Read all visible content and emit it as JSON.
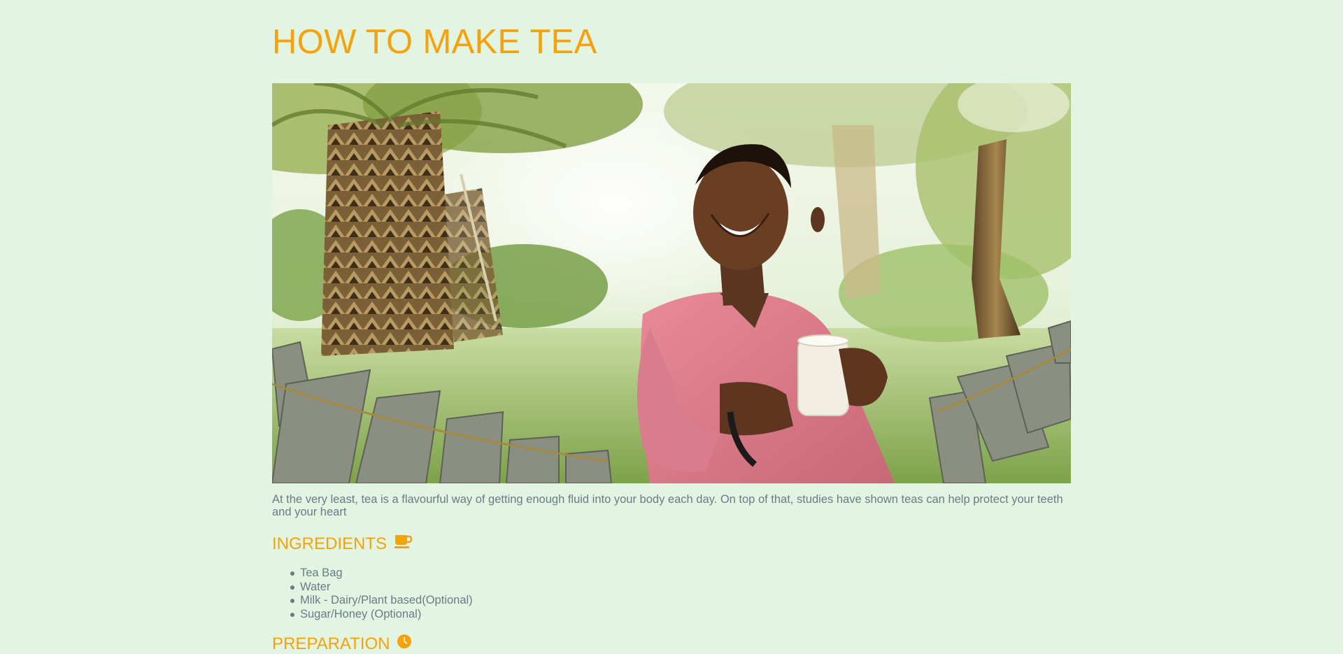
{
  "page": {
    "title": "HOW TO MAKE TEA",
    "intro": "At the very least, tea is a flavourful way of getting enough fluid into your body each day. On top of that, studies have shown teas can help protect your teeth and your heart"
  },
  "ingredients": {
    "heading": "INGREDIENTS",
    "icon": "coffee-cup-icon",
    "items": [
      "Tea Bag",
      "Water",
      "Milk - Dairy/Plant based(Optional)",
      "Sugar/Honey (Optional)"
    ]
  },
  "preparation": {
    "heading": "PREPARATION",
    "icon": "clock-icon"
  },
  "colors": {
    "background": "#e2f5e3",
    "accent": "#f5a20c",
    "text": "#6a7b86"
  }
}
